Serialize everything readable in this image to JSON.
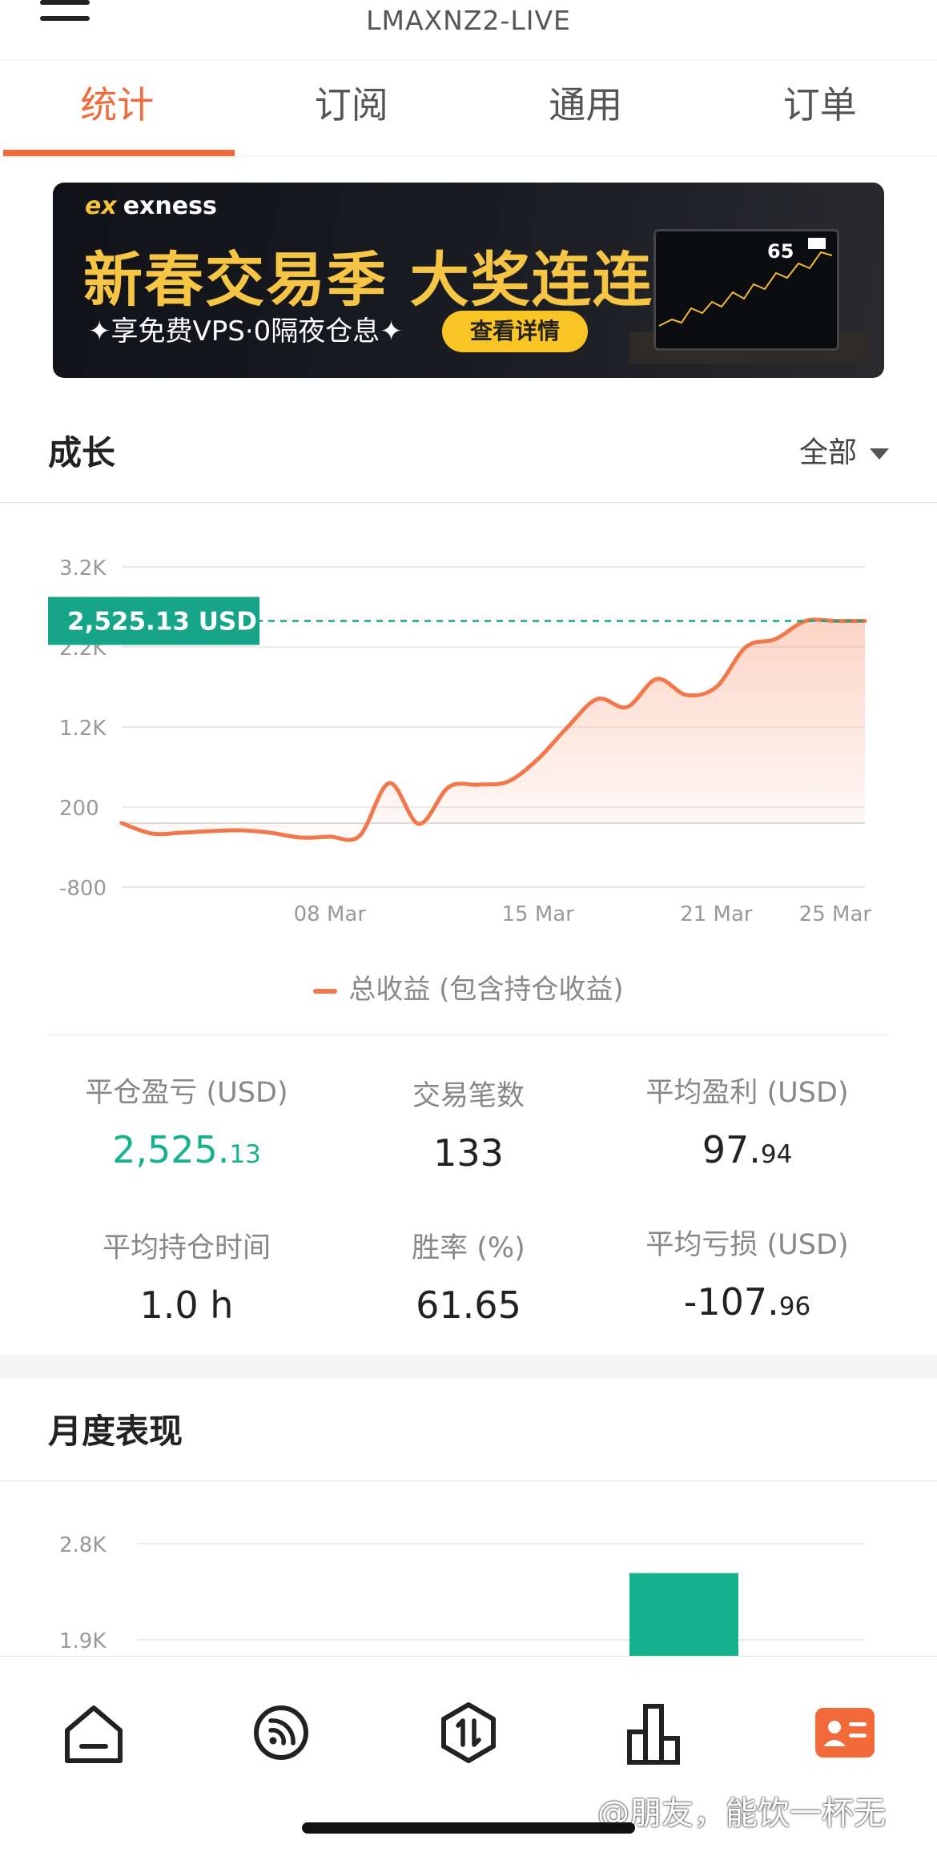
{
  "account": {
    "title": "LMAXNZ2-LIVE"
  },
  "tabs": [
    {
      "label": "统计",
      "active": true
    },
    {
      "label": "订阅",
      "active": false
    },
    {
      "label": "通用",
      "active": false
    },
    {
      "label": "订单",
      "active": false
    }
  ],
  "banner": {
    "brand": "exness",
    "brand_mark": "ex",
    "headline": "新春交易季 大奖连连抽",
    "subline": "✦享免费VPS·0隔夜仓息✦",
    "cta": "查看详情",
    "tv_number": "65"
  },
  "growth": {
    "title": "成长",
    "filter": "全部",
    "legend": "总收益 (包含持仓收益)",
    "current_value_label": "2,525.13 USD"
  },
  "stats": {
    "closed_pl": {
      "label": "平仓盈亏 (USD)",
      "int": "2,525.",
      "dec": "13"
    },
    "trades": {
      "label": "交易笔数",
      "value": "133"
    },
    "avg_profit": {
      "label": "平均盈利 (USD)",
      "int": "97.",
      "dec": "94"
    },
    "avg_hold": {
      "label": "平均持仓时间",
      "value": "1.0 h"
    },
    "win_rate": {
      "label": "胜率 (%)",
      "value": "61.65"
    },
    "avg_loss": {
      "label": "平均亏损 (USD)",
      "int": "-107.",
      "dec": "96"
    }
  },
  "monthly": {
    "title": "月度表现"
  },
  "bottom_nav": [
    {
      "icon": "home-icon"
    },
    {
      "icon": "subscription-feed-icon"
    },
    {
      "icon": "trade-icon"
    },
    {
      "icon": "stats-icon"
    },
    {
      "icon": "profile-card-icon",
      "active": true
    }
  ],
  "watermark": "@朋友，能饮一杯无",
  "colors": {
    "accent": "#f26a3a",
    "positive": "#16b18d",
    "line": "#f2784b",
    "label_bg": "#16a589"
  },
  "chart_data": [
    {
      "type": "area",
      "title": "",
      "series": [
        {
          "name": "总收益 (包含持仓收益)",
          "x": [
            "03-01",
            "03-02",
            "03-03",
            "03-04",
            "03-05",
            "03-06",
            "03-07",
            "03-08",
            "03-09",
            "03-10",
            "03-11",
            "03-12",
            "03-13",
            "03-14",
            "03-15",
            "03-16",
            "03-17",
            "03-18",
            "03-19",
            "03-20",
            "03-21",
            "03-22",
            "03-23",
            "03-24",
            "03-25",
            "03-26"
          ],
          "values": [
            0,
            -130,
            -120,
            -100,
            -90,
            -120,
            -180,
            -170,
            -160,
            500,
            -10,
            450,
            480,
            520,
            800,
            1200,
            1550,
            1450,
            1800,
            1600,
            1700,
            2200,
            2300,
            2525.13,
            2525.13,
            2525.13
          ]
        }
      ],
      "x_tick_labels": [
        "08 Mar",
        "15 Mar",
        "21 Mar",
        "25 Mar"
      ],
      "y_tick_labels": [
        "3.2K",
        "2.2K",
        "1.2K",
        "200",
        "-800"
      ],
      "ylim": [
        -800,
        3200
      ],
      "current_value": 2525.13,
      "grid": true,
      "legend": "bottom-center"
    },
    {
      "type": "bar",
      "title": "月度表现",
      "y_tick_labels": [
        "2.8K",
        "1.9K"
      ],
      "series": [
        {
          "values": [
            2525.13
          ]
        }
      ],
      "ylim": [
        0,
        2800
      ]
    }
  ]
}
